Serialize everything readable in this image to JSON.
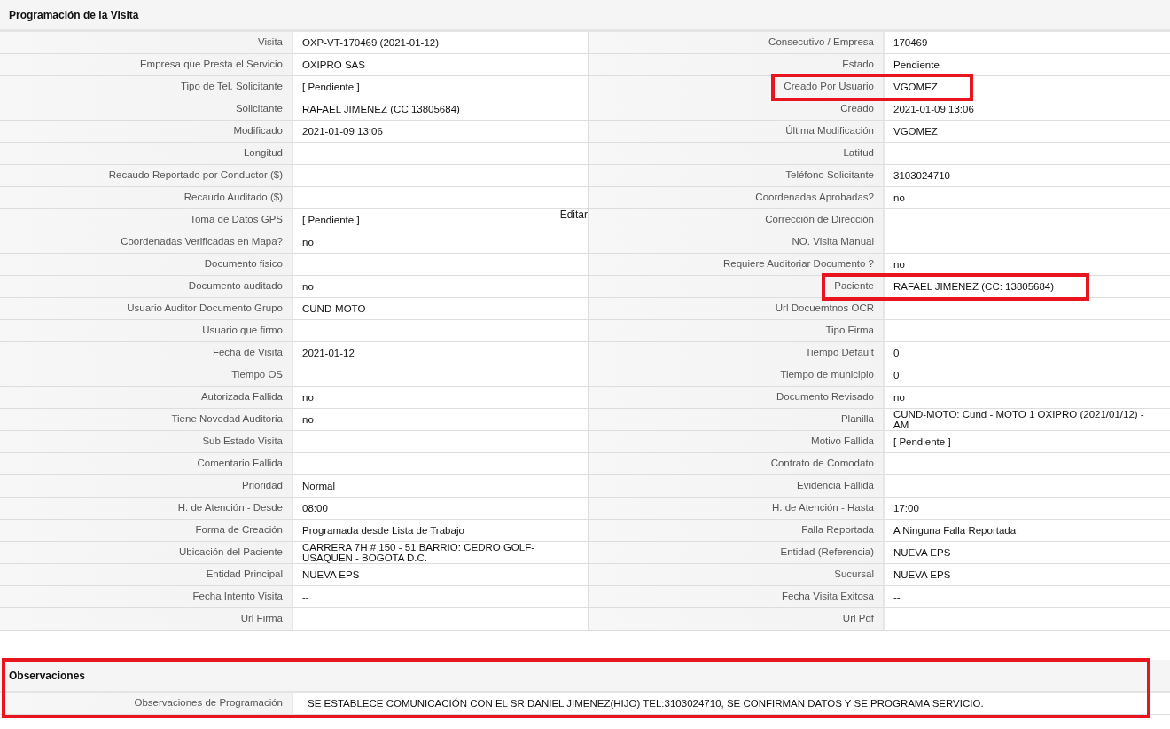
{
  "sections": [
    {
      "title": "Programación de la Visita",
      "rows": [
        {
          "left": {
            "label": "Visita",
            "value": "OXP-VT-170469 (2021-01-12)"
          },
          "right": {
            "label": "Consecutivo / Empresa",
            "value": "170469"
          }
        },
        {
          "left": {
            "label": "Empresa que Presta el Servicio",
            "value": "OXIPRO SAS"
          },
          "right": {
            "label": "Estado",
            "value": "Pendiente"
          }
        },
        {
          "left": {
            "label": "Tipo de Tel. Solicitante",
            "value": "[ Pendiente ]"
          },
          "right": {
            "label": "Creado Por Usuario",
            "value": "VGOMEZ",
            "highlighted": true
          }
        },
        {
          "left": {
            "label": "Solicitante",
            "value": "RAFAEL JIMENEZ (CC 13805684)"
          },
          "right": {
            "label": "Creado",
            "value": "2021-01-09 13:06"
          }
        },
        {
          "left": {
            "label": "Modificado",
            "value": "2021-01-09 13:06"
          },
          "right": {
            "label": "Última Modificación",
            "value": "VGOMEZ"
          }
        },
        {
          "left": {
            "label": "Longitud"
          },
          "right": {
            "label": "Latitud"
          }
        },
        {
          "left": {
            "label": "Recaudo Reportado por Conductor ($)"
          },
          "right": {
            "label": "Teléfono Solicitante",
            "value": "3103024710"
          }
        },
        {
          "left": {
            "label": "Recaudo Auditado ($)"
          },
          "right": {
            "label": "Coordenadas Aprobadas?",
            "value": "no"
          }
        },
        {
          "left": {
            "label": "Toma de Datos GPS",
            "value": "[ Pendiente ]",
            "action": "Editar"
          },
          "right": {
            "label": "Corrección de Dirección"
          }
        },
        {
          "left": {
            "label": "Coordenadas Verificadas en Mapa?",
            "value": "no"
          },
          "right": {
            "label": "NO. Visita Manual"
          }
        },
        {
          "left": {
            "label": "Documento fisico"
          },
          "right": {
            "label": "Requiere Auditoriar Documento ?",
            "value": "no"
          }
        },
        {
          "left": {
            "label": "Documento auditado",
            "value": "no"
          },
          "right": {
            "label": "Paciente",
            "value": "RAFAEL JIMENEZ (CC: 13805684)",
            "highlighted": true
          }
        },
        {
          "left": {
            "label": "Usuario Auditor Documento Grupo",
            "value": "CUND-MOTO"
          },
          "right": {
            "label": "Url Docuemtnos OCR"
          }
        },
        {
          "left": {
            "label": "Usuario que firmo"
          },
          "right": {
            "label": "Tipo Firma"
          }
        },
        {
          "left": {
            "label": "Fecha de Visita",
            "value": "2021-01-12"
          },
          "right": {
            "label": "Tiempo Default",
            "value": "0"
          }
        },
        {
          "left": {
            "label": "Tiempo OS"
          },
          "right": {
            "label": "Tiempo de municipio",
            "value": "0"
          }
        },
        {
          "left": {
            "label": "Autorizada Fallida",
            "value": "no"
          },
          "right": {
            "label": "Documento Revisado",
            "value": "no"
          }
        },
        {
          "left": {
            "label": "Tiene Novedad Auditoria",
            "value": "no"
          },
          "right": {
            "label": "Planilla",
            "value": "CUND-MOTO: Cund - MOTO 1 OXIPRO (2021/01/12) - AM"
          }
        },
        {
          "left": {
            "label": "Sub Estado Visita"
          },
          "right": {
            "label": "Motivo Fallida",
            "value": "[ Pendiente ]"
          }
        },
        {
          "left": {
            "label": "Comentario Fallida"
          },
          "right": {
            "label": "Contrato de Comodato"
          }
        },
        {
          "left": {
            "label": "Prioridad",
            "value": "Normal"
          },
          "right": {
            "label": "Evidencia Fallida"
          }
        },
        {
          "left": {
            "label": "H. de Atención - Desde",
            "value": "08:00"
          },
          "right": {
            "label": "H. de Atención - Hasta",
            "value": "17:00"
          }
        },
        {
          "left": {
            "label": "Forma de Creación",
            "value": "Programada desde Lista de Trabajo"
          },
          "right": {
            "label": "Falla Reportada",
            "value": "A Ninguna Falla Reportada"
          }
        },
        {
          "left": {
            "label": "Ubicación del Paciente",
            "value": "CARRERA 7H # 150 - 51 BARRIO: CEDRO GOLF-USAQUEN - BOGOTA D.C."
          },
          "right": {
            "label": "Entidad (Referencia)",
            "value": "NUEVA EPS"
          }
        },
        {
          "left": {
            "label": "Entidad Principal",
            "value": "NUEVA EPS"
          },
          "right": {
            "label": "Sucursal",
            "value": "NUEVA EPS"
          }
        },
        {
          "left": {
            "label": "Fecha Intento Visita",
            "value": "--"
          },
          "right": {
            "label": "Fecha Visita Exitosa",
            "value": "--"
          }
        },
        {
          "left": {
            "label": "Url Firma"
          },
          "right": {
            "label": "Url Pdf"
          }
        }
      ]
    },
    {
      "title": "Observaciones",
      "highlighted": true,
      "rows": [
        {
          "wide": {
            "label": "Observaciones de Programación",
            "value": "SE ESTABLECE COMUNICACIÓN CON EL SR DANIEL JIMENEZ(HIJO) TEL:3103024710, SE CONFIRMAN DATOS Y SE PROGRAMA SERVICIO."
          }
        }
      ]
    }
  ]
}
